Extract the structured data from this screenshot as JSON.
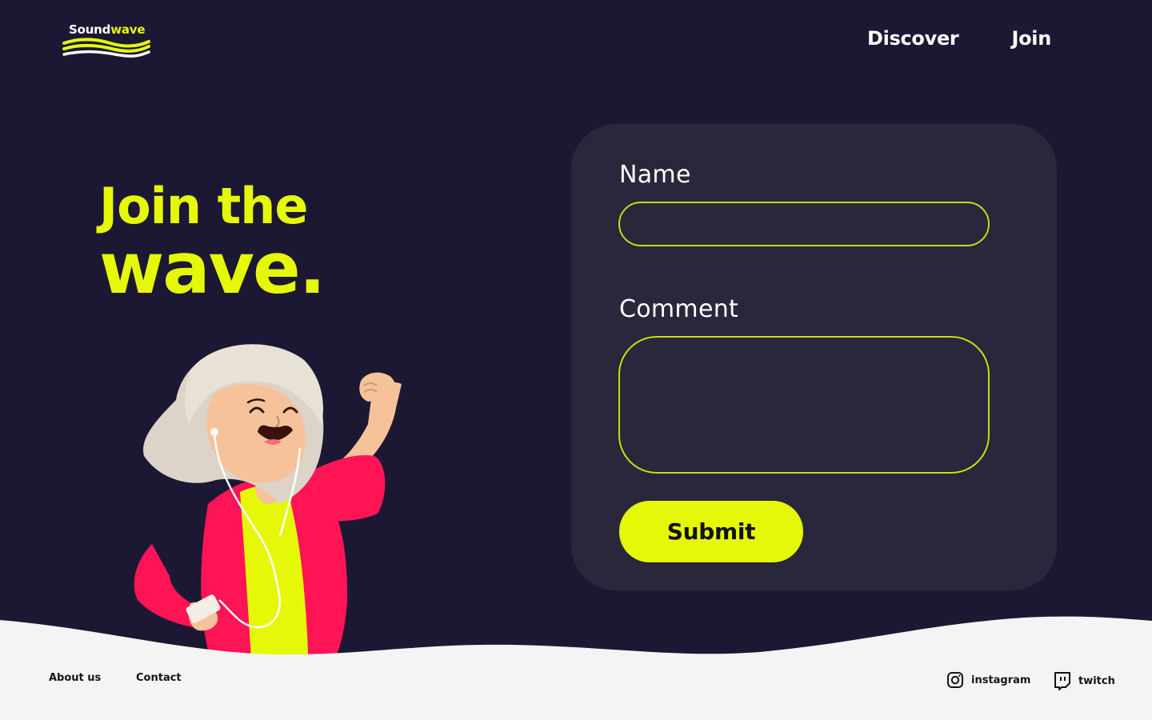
{
  "brand": {
    "name_part1": "Sound",
    "name_part2": "wave",
    "accent_color": "#e4f808",
    "background_color": "#1c1833"
  },
  "nav": {
    "items": [
      {
        "label": "Discover"
      },
      {
        "label": "Join"
      }
    ]
  },
  "hero": {
    "line1": "Join the",
    "line2": "wave."
  },
  "form": {
    "name_label": "Name",
    "name_value": "",
    "comment_label": "Comment",
    "comment_value": "",
    "submit_label": "Submit"
  },
  "illustration": {
    "icon": "woman-dancing-with-earphones-illustration"
  },
  "footer": {
    "links": [
      {
        "label": "About us"
      },
      {
        "label": "Contact"
      }
    ],
    "social": [
      {
        "label": "instagram",
        "icon": "instagram-icon"
      },
      {
        "label": "twitch",
        "icon": "twitch-icon"
      }
    ]
  }
}
